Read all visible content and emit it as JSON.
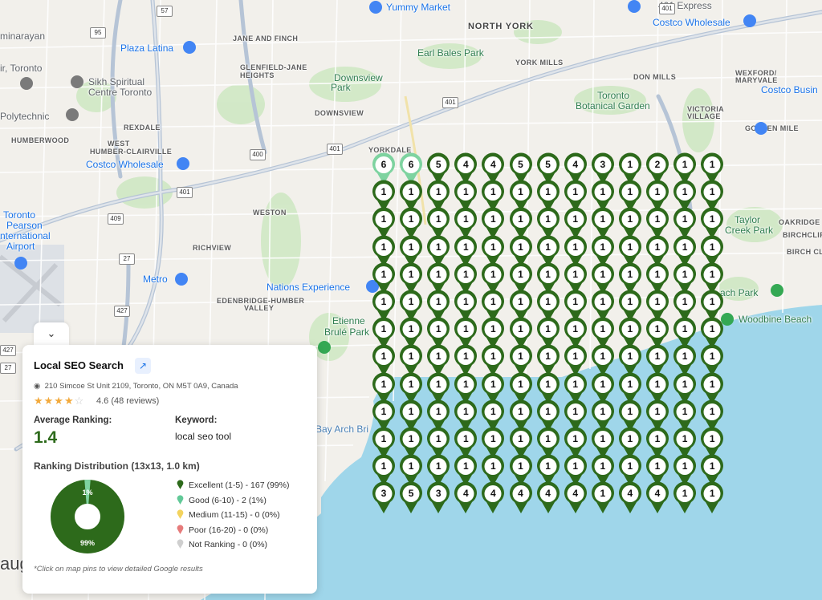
{
  "map": {
    "labels": [
      {
        "text": "Yummy Market",
        "cls": "blue"
      },
      {
        "text": "NORTH YORK",
        "cls": "big"
      },
      {
        "text": "Costco Wholesale",
        "cls": "blue"
      },
      {
        "text": "401 Express",
        "cls": ""
      },
      {
        "text": "Plaza Latina",
        "cls": "blue"
      },
      {
        "text": "JANE AND FINCH",
        "cls": "caps"
      },
      {
        "text": "Earl Bales Park",
        "cls": "park"
      },
      {
        "text": "YORK MILLS",
        "cls": "caps"
      },
      {
        "text": "WEXFORD/",
        "cls": "caps"
      },
      {
        "text": "MARYVALE",
        "cls": "caps"
      },
      {
        "text": "minarayan",
        "cls": ""
      },
      {
        "text": "ir, Toronto",
        "cls": ""
      },
      {
        "text": "Sikh Spiritual",
        "cls": ""
      },
      {
        "text": "Centre Toronto",
        "cls": ""
      },
      {
        "text": "GLENFIELD-JANE",
        "cls": "caps"
      },
      {
        "text": "HEIGHTS",
        "cls": "caps"
      },
      {
        "text": "Downsview",
        "cls": "park"
      },
      {
        "text": "Park",
        "cls": "park"
      },
      {
        "text": "DON MILLS",
        "cls": "caps"
      },
      {
        "text": "Toronto",
        "cls": "park"
      },
      {
        "text": "Botanical Garden",
        "cls": "park"
      },
      {
        "text": "Costco Busin",
        "cls": "blue"
      },
      {
        "text": "Polytechnic",
        "cls": ""
      },
      {
        "text": "DOWNSVIEW",
        "cls": "caps"
      },
      {
        "text": "VICTORIA",
        "cls": "caps"
      },
      {
        "text": "VILLAGE",
        "cls": "caps"
      },
      {
        "text": "REXDALE",
        "cls": "caps"
      },
      {
        "text": "GOLDEN MILE",
        "cls": "caps"
      },
      {
        "text": "HUMBERWOOD",
        "cls": "caps"
      },
      {
        "text": "WEST",
        "cls": "caps"
      },
      {
        "text": "HUMBER-CLAIRVILLE",
        "cls": "caps"
      },
      {
        "text": "Costco Wholesale",
        "cls": "blue"
      },
      {
        "text": "YORKDALE",
        "cls": "caps"
      },
      {
        "text": "Toronto",
        "cls": "blue"
      },
      {
        "text": "Pearson",
        "cls": "blue"
      },
      {
        "text": "nternational",
        "cls": "blue"
      },
      {
        "text": "Airport",
        "cls": "blue"
      },
      {
        "text": "WESTON",
        "cls": "caps"
      },
      {
        "text": "Taylor",
        "cls": "park"
      },
      {
        "text": "Creek Park",
        "cls": "park"
      },
      {
        "text": "OAKRIDGE",
        "cls": "caps"
      },
      {
        "text": "BIRCHCLIF",
        "cls": "caps"
      },
      {
        "text": "RICHVIEW",
        "cls": "caps"
      },
      {
        "text": "BIRCH CL",
        "cls": "caps"
      },
      {
        "text": "Metro",
        "cls": "blue"
      },
      {
        "text": "Nations Experience",
        "cls": "blue"
      },
      {
        "text": "EDENBRIDGE-HUMBER",
        "cls": "caps"
      },
      {
        "text": "VALLEY",
        "cls": "caps"
      },
      {
        "text": "ach Park",
        "cls": "park"
      },
      {
        "text": "Woodbine Beach",
        "cls": "park"
      },
      {
        "text": "Etienne",
        "cls": "park"
      },
      {
        "text": "Brulé Park",
        "cls": "park"
      },
      {
        "text": "Bay Arch Bri",
        "cls": "water"
      },
      {
        "text": "aug",
        "cls": ""
      }
    ],
    "highway_shields": [
      "57",
      "401",
      "95",
      "401",
      "400",
      "401",
      "401",
      "409",
      "27",
      "427",
      "27",
      "427"
    ]
  },
  "grid": {
    "rows": [
      [
        6,
        6,
        5,
        4,
        4,
        5,
        5,
        4,
        3,
        1,
        2,
        1,
        1
      ],
      [
        1,
        1,
        1,
        1,
        1,
        1,
        1,
        1,
        1,
        1,
        1,
        1,
        1
      ],
      [
        1,
        1,
        1,
        1,
        1,
        1,
        1,
        1,
        1,
        1,
        1,
        1,
        1
      ],
      [
        1,
        1,
        1,
        1,
        1,
        1,
        1,
        1,
        1,
        1,
        1,
        1,
        1
      ],
      [
        1,
        1,
        1,
        1,
        1,
        1,
        1,
        1,
        1,
        1,
        1,
        1,
        1
      ],
      [
        1,
        1,
        1,
        1,
        1,
        1,
        1,
        1,
        1,
        1,
        1,
        1,
        1
      ],
      [
        1,
        1,
        1,
        1,
        1,
        1,
        1,
        1,
        1,
        1,
        1,
        1,
        1
      ],
      [
        1,
        1,
        1,
        1,
        1,
        1,
        1,
        1,
        1,
        1,
        1,
        1,
        1
      ],
      [
        1,
        1,
        1,
        1,
        1,
        1,
        1,
        1,
        1,
        1,
        1,
        1,
        1
      ],
      [
        1,
        1,
        1,
        1,
        1,
        1,
        1,
        1,
        1,
        1,
        1,
        1,
        1
      ],
      [
        1,
        1,
        1,
        1,
        1,
        1,
        1,
        1,
        1,
        1,
        1,
        1,
        1
      ],
      [
        1,
        1,
        1,
        1,
        1,
        1,
        1,
        1,
        1,
        1,
        1,
        1,
        1
      ],
      [
        3,
        5,
        3,
        4,
        4,
        4,
        4,
        4,
        1,
        4,
        4,
        1,
        1
      ]
    ],
    "colors": {
      "excellent": "#2d6a1b",
      "good": "#7ed3a0"
    }
  },
  "panel": {
    "collapse_icon": "chevron-down-icon",
    "business_name": "Local SEO Search",
    "address": "210 Simcoe St Unit 2109, Toronto, ON M5T 0A9, Canada",
    "rating_stars": 4,
    "rating_text": "4.6 (48 reviews)",
    "avg_label": "Average Ranking:",
    "avg_value": "1.4",
    "keyword_label": "Keyword:",
    "keyword_value": "local seo tool",
    "distribution_title": "Ranking Distribution (13x13, 1.0 km)",
    "donut": {
      "excellent_pct": 99,
      "good_pct": 1,
      "inner_label": "1%",
      "outer_label": "99%"
    },
    "legend": [
      {
        "label": "Excellent (1-5) - 167 (99%)",
        "color": "#2d6a1b"
      },
      {
        "label": "Good (6-10) - 2 (1%)",
        "color": "#62c998"
      },
      {
        "label": "Medium (11-15) - 0 (0%)",
        "color": "#f3d35e"
      },
      {
        "label": "Poor (16-20) - 0 (0%)",
        "color": "#e67b7b"
      },
      {
        "label": "Not Ranking - 0 (0%)",
        "color": "#cfcfcf"
      }
    ],
    "note": "*Click on map pins to view detailed Google results"
  }
}
